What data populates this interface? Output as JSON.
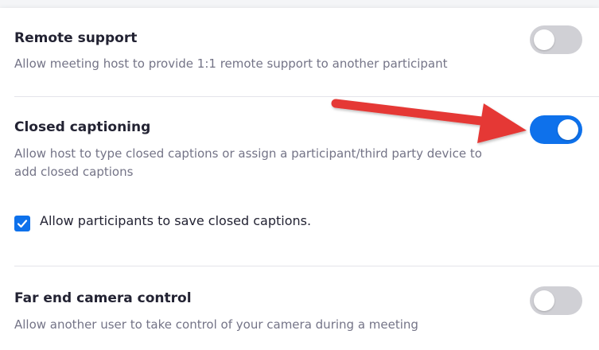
{
  "settings": [
    {
      "title": "Remote support",
      "description": "Allow meeting host to provide 1:1 remote support to another participant",
      "enabled": false
    },
    {
      "title": "Closed captioning",
      "description": "Allow host to type closed captions or assign a participant/third party device to add closed captions",
      "enabled": true,
      "option": {
        "label": "Allow participants to save closed captions.",
        "checked": true
      }
    },
    {
      "title": "Far end camera control",
      "description": "Allow another user to take control of your camera during a meeting",
      "enabled": false
    }
  ],
  "colors": {
    "accent": "#0e71eb",
    "toggle_off": "#d0d0d5",
    "annotation_arrow": "#e53935"
  }
}
